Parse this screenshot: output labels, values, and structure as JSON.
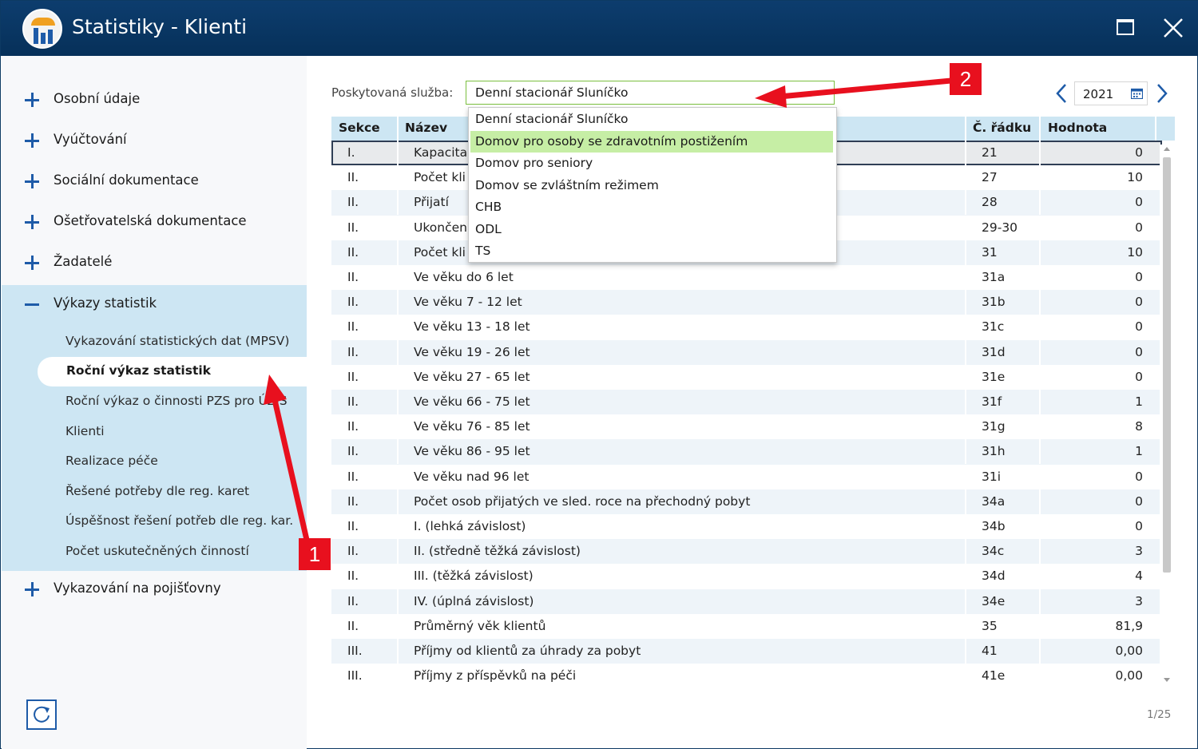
{
  "window": {
    "title": "Statistiky - Klienti"
  },
  "sidebar": {
    "items": [
      {
        "label": "Osobní údaje"
      },
      {
        "label": "Vyúčtování"
      },
      {
        "label": "Sociální dokumentace"
      },
      {
        "label": "Ošetřovatelská dokumentace"
      },
      {
        "label": "Žadatelé"
      },
      {
        "label": "Výkazy statistik"
      },
      {
        "label": "Vykazování na pojišťovny"
      }
    ],
    "subitems": [
      {
        "label": "Vykazování statistických dat (MPSV)"
      },
      {
        "label": "Roční výkaz statistik"
      },
      {
        "label": "Roční výkaz o činnosti PZS pro ÚZIS"
      },
      {
        "label": "Klienti"
      },
      {
        "label": "Realizace péče"
      },
      {
        "label": "Řešené potřeby dle reg. karet"
      },
      {
        "label": "Úspěšnost řešení potřeb dle reg. kar."
      },
      {
        "label": "Počet uskutečněných činností"
      }
    ]
  },
  "filter": {
    "service_label": "Poskytovaná služba:",
    "service_value": "Denní stacionář Sluníčko",
    "year": "2021",
    "options": [
      "Denní stacionář Sluníčko",
      "Domov pro osoby se zdravotním postižením",
      "Domov pro seniory",
      "Domov se zvláštním režimem",
      "CHB",
      "ODL",
      "TS"
    ]
  },
  "table": {
    "columns": [
      "Sekce",
      "Název",
      "Č. řádku",
      "Hodnota"
    ],
    "rows": [
      [
        "I.",
        "Kapacita",
        "21",
        "0"
      ],
      [
        "II.",
        "Počet kli",
        "27",
        "10"
      ],
      [
        "II.",
        "Přijatí",
        "28",
        "0"
      ],
      [
        "II.",
        "Ukončen",
        "29-30",
        "0"
      ],
      [
        "II.",
        "Počet kli",
        "31",
        "10"
      ],
      [
        "II.",
        "Ve věku do 6 let",
        "31a",
        "0"
      ],
      [
        "II.",
        "Ve věku 7 - 12 let",
        "31b",
        "0"
      ],
      [
        "II.",
        "Ve věku 13 - 18 let",
        "31c",
        "0"
      ],
      [
        "II.",
        "Ve věku 19 - 26 let",
        "31d",
        "0"
      ],
      [
        "II.",
        "Ve věku 27 - 65 let",
        "31e",
        "0"
      ],
      [
        "II.",
        "Ve věku 66 - 75 let",
        "31f",
        "1"
      ],
      [
        "II.",
        "Ve věku 76 - 85 let",
        "31g",
        "8"
      ],
      [
        "II.",
        "Ve věku 86 - 95 let",
        "31h",
        "1"
      ],
      [
        "II.",
        "Ve věku nad 96 let",
        "31i",
        "0"
      ],
      [
        "II.",
        "Počet osob přijatých ve sled. roce na přechodný pobyt",
        "34a",
        "0"
      ],
      [
        "II.",
        "I. (lehká závislost)",
        "34b",
        "0"
      ],
      [
        "II.",
        "II. (středně těžká závislost)",
        "34c",
        "3"
      ],
      [
        "II.",
        "III. (těžká závislost)",
        "34d",
        "4"
      ],
      [
        "II.",
        "IV. (úplná závislost)",
        "34e",
        "3"
      ],
      [
        "II.",
        "Průměrný věk klientů",
        "35",
        "81,9"
      ],
      [
        "III.",
        "Příjmy od klientů za úhrady za pobyt",
        "41",
        "0,00"
      ],
      [
        "III.",
        "Příjmy z příspěvků na péči",
        "41e",
        "0,00"
      ]
    ]
  },
  "pager": {
    "text": "1/25"
  },
  "annotations": {
    "badge1": "1",
    "badge2": "2"
  },
  "colors": {
    "accent": "#1e5ba8",
    "titlebar": "#0a3765",
    "highlight": "#c6eea5",
    "annotation": "#e8101e"
  }
}
